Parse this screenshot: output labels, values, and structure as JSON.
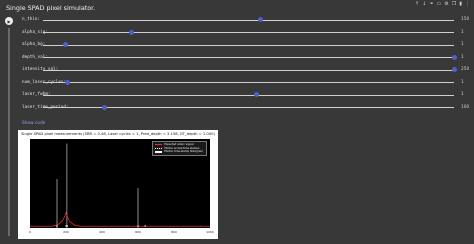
{
  "page": {
    "title": "Single SPAD pixel simulator."
  },
  "toolbar": {
    "icons": [
      "arrow-up-icon",
      "arrow-down-icon",
      "link-icon",
      "comment-icon",
      "settings-icon",
      "copy-icon",
      "delete-icon",
      "more-icon"
    ]
  },
  "sliders": [
    {
      "label": "n_thin:",
      "value": "150",
      "fraction": 0.53
    },
    {
      "label": "alpha_sig:",
      "value": "1",
      "fraction": 0.215
    },
    {
      "label": "alpha_bg:",
      "value": "1",
      "fraction": 0.055
    },
    {
      "label": "depth_val:",
      "value": "1",
      "fraction": 1.0
    },
    {
      "label": "intensity_val:",
      "value": "250",
      "fraction": 1.0
    },
    {
      "label": "num_laser_cycles:",
      "value": "1",
      "fraction": 0.06
    },
    {
      "label": "laser_fwhm:",
      "value": "1",
      "fraction": 0.52
    },
    {
      "label": "laser_time_period:",
      "value": "100",
      "fraction": 0.15
    }
  ],
  "show_code": "Show code",
  "chart_data": {
    "type": "line",
    "title": "Single SPAD pixel measurements (SBR = 0.48, Laser cycles = 1, Pred_depth = 3.158, GT_depth = 1.000)",
    "xlim": [
      0,
      1000
    ],
    "ylim": [
      0,
      1
    ],
    "x_ticks": [
      "0",
      "200",
      "400",
      "600",
      "800",
      "1000"
    ],
    "legend": [
      "Expected return signal",
      "Photon arrival time stamps",
      "Photon time-stamp histogram"
    ],
    "legend_placement": "top-right",
    "series": [
      {
        "name": "Expected return signal",
        "color": "#e03030",
        "x": [
          0,
          120,
          150,
          180,
          195,
          200,
          205,
          220,
          250,
          280,
          1000
        ],
        "y": [
          0.02,
          0.02,
          0.03,
          0.08,
          0.14,
          0.17,
          0.14,
          0.07,
          0.03,
          0.02,
          0.02
        ]
      }
    ],
    "timestamps_x": [
      150,
      200,
      207,
      600,
      640
    ],
    "timestamps_color": "#ffffff",
    "histogram_spikes": [
      {
        "x": 205,
        "h": 0.95
      },
      {
        "x": 150,
        "h": 0.55
      },
      {
        "x": 600,
        "h": 0.45
      }
    ],
    "background_color": "#000000"
  }
}
